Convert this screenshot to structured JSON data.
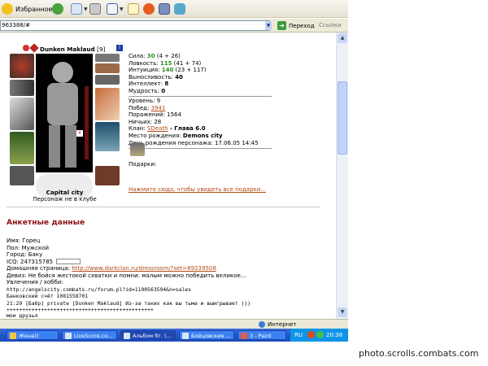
{
  "toolbar": {
    "favorites_label": "Избранное"
  },
  "address": {
    "url": "963388/#",
    "go_label": "Переход",
    "links_label": "Ссылки"
  },
  "profile": {
    "name": "Dunken Maklaud",
    "level_tag": "[9]",
    "stats": [
      {
        "label": "Сила: ",
        "value": "30",
        "extra": " (4 + 26)"
      },
      {
        "label": "Ловкость: ",
        "value": "115",
        "extra": " (41 + 74)"
      },
      {
        "label": "Интуиция: ",
        "value": "140",
        "extra": " (23 + 117)"
      },
      {
        "label": "Выносливость: ",
        "value": "40",
        "extra": ""
      },
      {
        "label": "Интеллект: ",
        "value": "8",
        "extra": ""
      },
      {
        "label": "Мудрость: ",
        "value": "0",
        "extra": ""
      }
    ],
    "level": "Уровень: 9",
    "wins_label": "Побед: ",
    "wins": "3941",
    "losses": "Поражений: 1564",
    "draws": "Ничьих: 28",
    "clan_label": "Клан: ",
    "clan_name": "SDeath",
    "clan_rank": " - Глава 6.0",
    "birthplace_label": "Место рождения: ",
    "birthplace": "Demons city",
    "birthday": "День рождения персонажа: 17.06.05 14:45",
    "gifts_label": "Подарки:",
    "gifts_link": "Нажмите сюда, чтобы увидеть все подарки...",
    "city": "Capital city",
    "club_status": "Персонаж не в клубе"
  },
  "questionnaire": {
    "heading": "Анкетные данные",
    "name": "Имя: Горец",
    "gender": "Пол: Мужской",
    "town": "Город: Баку",
    "icq": "ICQ: 247315785",
    "homepage_label": "Домашняя страница: ",
    "homepage_url": "http://www.darkclan.ru/dressroom/?set=89239508",
    "motto": "Девиз: Не бойся жестокой схватки и помни: малым можно победить великое...",
    "hobbies": "Увлечения / хобби:",
    "lines": [
      "http://angelscity.combats.ru/forum.pl?id=1190563594&n=sales",
      "Банковский счёт 1081558701",
      "21:29 [Бабр] private [Dunken Maklaud] Из-за таких как вы тьма и выигрывает )))",
      "+++++++++++++++++++++++++++++++++++++++++++++++",
      "мои друзья"
    ]
  },
  "status_bar": {
    "zone": "Интернет"
  },
  "taskbar": {
    "items": [
      "Жена))",
      "LiveScore.co...",
      "Альбом бг. (...",
      "Бойцовские ...",
      "3 - Paint"
    ],
    "lang": "RU",
    "clock": "20:38"
  },
  "watermark": "photo.scrolls.combats.com"
}
